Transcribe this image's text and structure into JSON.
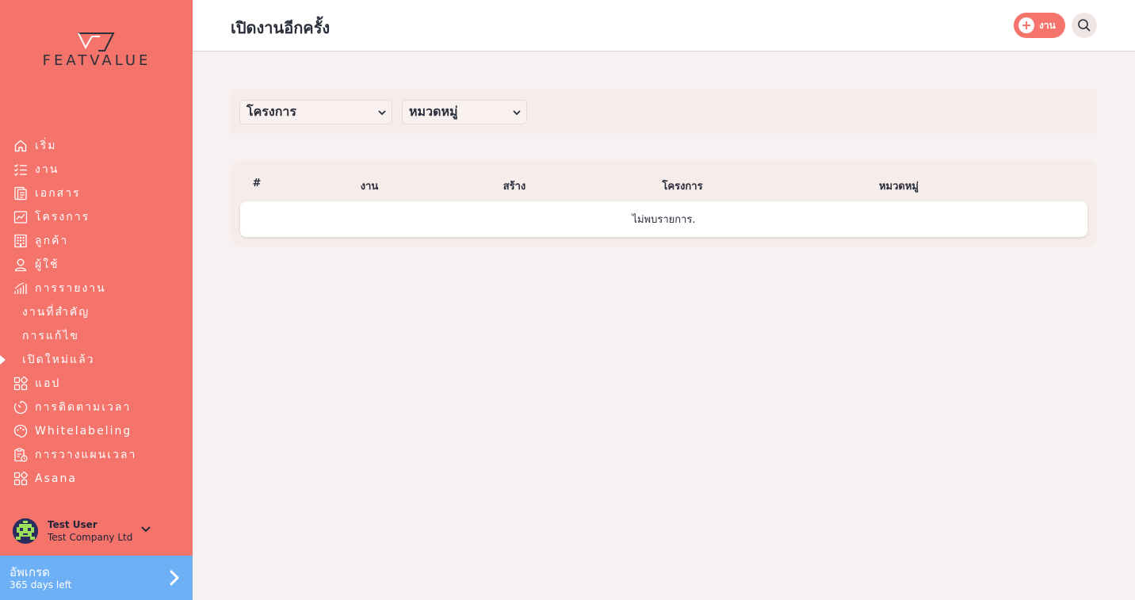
{
  "brand": {
    "name": "FEATVALUE"
  },
  "sidebar": {
    "items": [
      {
        "label": "เริ่ม",
        "icon": "home-icon"
      },
      {
        "label": "งาน",
        "icon": "tasks-list-icon"
      },
      {
        "label": "เอกสาร",
        "icon": "document-icon"
      },
      {
        "label": "โครงการ",
        "icon": "chart-board-icon"
      },
      {
        "label": "ลูกค้า",
        "icon": "building-icon"
      },
      {
        "label": "ผู้ใช้",
        "icon": "user-icon"
      },
      {
        "label": "การรายงาน",
        "icon": "bar-chart-icon"
      },
      {
        "label": "งานที่สำคัญ",
        "sub": true
      },
      {
        "label": "การแก้ไข",
        "sub": true
      },
      {
        "label": "เปิดใหม่แล้ว",
        "sub": true,
        "active": true
      },
      {
        "label": "แอป",
        "icon": "apps-icon"
      },
      {
        "label": "การติดตามเวลา",
        "icon": "timer-icon"
      },
      {
        "label": "Whitelabeling",
        "icon": "palette-icon"
      },
      {
        "label": "การวางแผนเวลา",
        "icon": "clipboard-clock-icon"
      },
      {
        "label": "Asana",
        "icon": "apps-icon"
      }
    ],
    "user": {
      "name": "Test User",
      "company": "Test Company Ltd"
    },
    "upgrade": {
      "title": "อัพเกรด",
      "subtitle": "365 days left"
    }
  },
  "header": {
    "title": "เปิดงานอีกครั้ง",
    "add_label": "งาน"
  },
  "filters": {
    "project": "โครงการ",
    "category": "หมวดหมู่"
  },
  "table": {
    "columns": [
      "#",
      "งาน",
      "สร้าง",
      "โครงการ",
      "หมวดหมู่"
    ],
    "empty_message": "ไม่พบรายการ."
  },
  "colors": {
    "sidebar": "#f4736b",
    "upgrade": "#6db0f5",
    "accent": "#f4736b"
  }
}
